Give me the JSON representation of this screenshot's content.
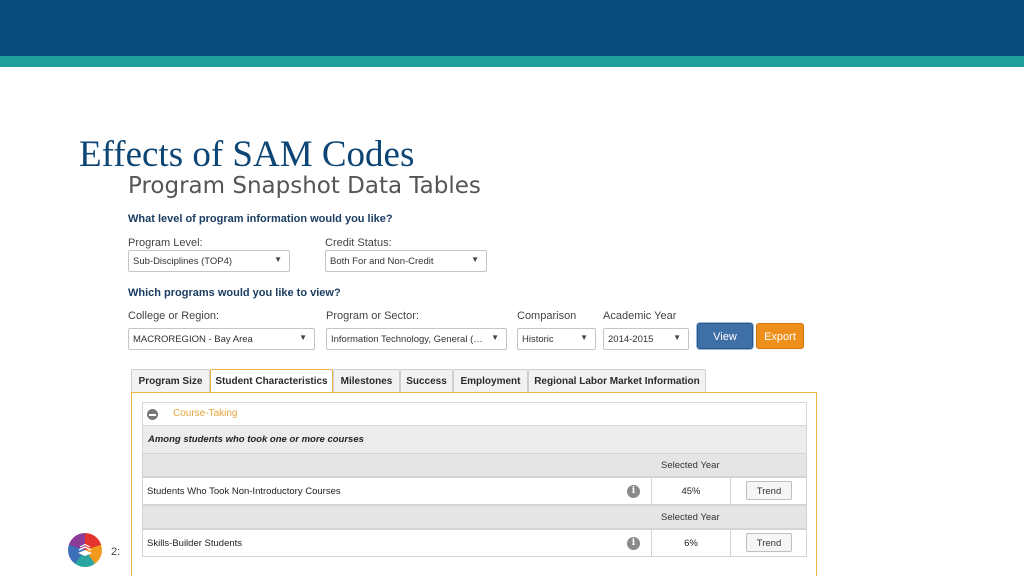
{
  "slide": {
    "title": "Effects of SAM Codes",
    "page_number": "2:"
  },
  "app": {
    "title": "Program Snapshot Data Tables"
  },
  "filters": {
    "question1": "What level of program information would you like?",
    "program_level": {
      "label": "Program Level:",
      "value": "Sub-Disciplines (TOP4)"
    },
    "credit_status": {
      "label": "Credit Status:",
      "value": "Both For and Non-Credit"
    },
    "question2": "Which programs would you like to view?",
    "college_region": {
      "label": "College or Region:",
      "value": "MACROREGION - Bay Area"
    },
    "program_sector": {
      "label": "Program or Sector:",
      "value": "Information Technology, General (070..."
    },
    "comparison": {
      "label": "Comparison",
      "value": "Historic"
    },
    "academic_year": {
      "label": "Academic Year",
      "value": "2014-2015"
    },
    "view_label": "View",
    "export_label": "Export"
  },
  "tabs": [
    {
      "label": "Program Size"
    },
    {
      "label": "Student Characteristics",
      "active": true
    },
    {
      "label": "Milestones"
    },
    {
      "label": "Success"
    },
    {
      "label": "Employment"
    },
    {
      "label": "Regional Labor Market Information"
    }
  ],
  "panel": {
    "section_title": "Course-Taking",
    "subheading": "Among students who took one or more courses",
    "rows": [
      {
        "header": "Selected Year",
        "name": "Students Who Took Non-Introductory Courses",
        "value": "45%",
        "trend": "Trend"
      },
      {
        "header": "Selected Year",
        "name": "Skills-Builder Students",
        "value": "6%",
        "trend": "Trend"
      }
    ]
  },
  "colors": {
    "top_bar": "#0a4b7e",
    "accent_band": "#1f9e9a",
    "view_button": "#3e6fa6",
    "export_button": "#ee8f1c",
    "active_tab_border": "#f0b24a"
  }
}
